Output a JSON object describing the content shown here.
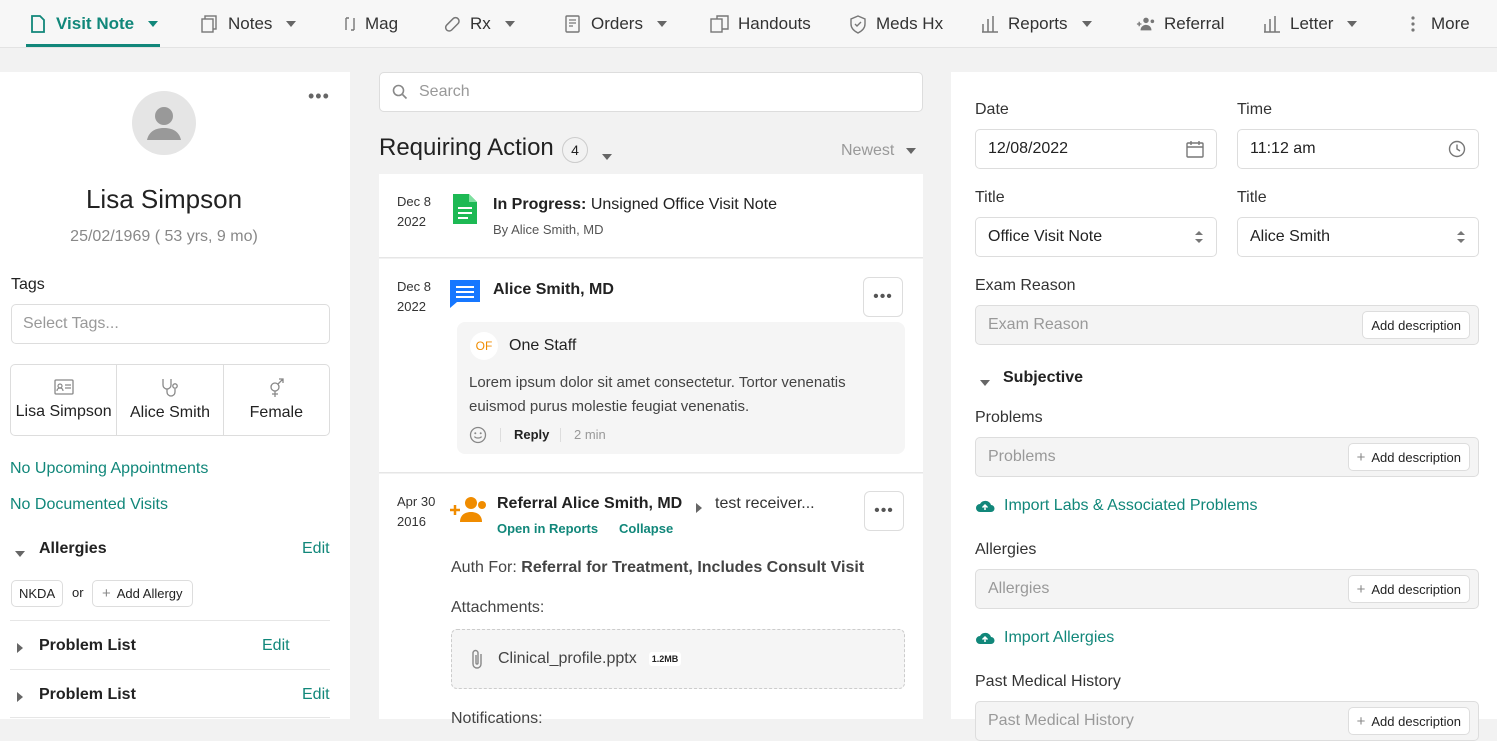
{
  "nav": {
    "items": [
      {
        "label": "Visit Note",
        "icon": "document-icon"
      },
      {
        "label": "Notes",
        "icon": "notes-icon"
      },
      {
        "label": "Mag",
        "icon": "mag-icon"
      },
      {
        "label": "Rx",
        "icon": "pill-icon"
      },
      {
        "label": "Orders",
        "icon": "orders-icon"
      },
      {
        "label": "Handouts",
        "icon": "handouts-icon"
      },
      {
        "label": "Meds Hx",
        "icon": "shield-icon"
      },
      {
        "label": "Reports",
        "icon": "bar-chart-icon"
      },
      {
        "label": "Referral",
        "icon": "people-icon"
      },
      {
        "label": "Letter",
        "icon": "bar-chart-icon"
      },
      {
        "label": "More",
        "icon": "kebab-icon"
      }
    ]
  },
  "patient": {
    "name": "Lisa Simpson",
    "dob": "25/02/1969 ( 53 yrs, 9 mo)",
    "tags_label": "Tags",
    "tags_placeholder": "Select Tags...",
    "info": [
      {
        "label": "Lisa Simpson",
        "icon": "id-card-icon"
      },
      {
        "label": "Alice Smith",
        "icon": "stethoscope-icon"
      },
      {
        "label": "Female",
        "icon": "gender-icon"
      }
    ],
    "no_appointments": "No Upcoming Appointments",
    "no_visits": "No Documented Visits",
    "allergies_title": "Allergies",
    "edit": "Edit",
    "nkda": "NKDA",
    "or": "or",
    "add_allergy": "Add Allergy",
    "problem_list_1": "Problem List",
    "problem_list_2": "Problem List"
  },
  "feed": {
    "search_placeholder": "Search",
    "title": "Requiring Action",
    "count": "4",
    "sort": "Newest",
    "items": [
      {
        "date_md": "Dec 8",
        "date_y": "2022",
        "title_bold": "In Progress:",
        "title_rest": "Unsigned Office Visit Note",
        "subtitle": "By Alice Smith, MD"
      },
      {
        "date_md": "Dec 8",
        "date_y": "2022",
        "title": "Alice Smith, MD",
        "staff_initials": "OF",
        "staff_name": "One Staff",
        "message": "Lorem ipsum dolor sit amet consectetur. Tortor venenatis euismod purus molestie feugiat venenatis.",
        "reply": "Reply",
        "time": "2 min"
      },
      {
        "date_md": "Apr 30",
        "date_y": "2016",
        "title": "Referral Alice Smith, MD",
        "receiver": "test receiver...",
        "open_reports": "Open in Reports",
        "collapse": "Collapse",
        "auth_label": "Auth For:",
        "auth_value": "Referral for Treatment, Includes Consult Visit",
        "attachments_label": "Attachments:",
        "file_name": "Clinical_profile.pptx",
        "file_size": "1.2MB",
        "notifications_label": "Notifications:"
      }
    ]
  },
  "form": {
    "date_label": "Date",
    "date_value": "12/08/2022",
    "time_label": "Time",
    "time_value": "11:12 am",
    "title_label_1": "Title",
    "title_value_1": "Office Visit Note",
    "title_label_2": "Title",
    "title_value_2": "Alice Smith",
    "exam_label": "Exam Reason",
    "exam_placeholder": "Exam Reason",
    "add_description": "Add description",
    "subjective": "Subjective",
    "problems_label": "Problems",
    "problems_placeholder": "Problems",
    "import_labs": "Import Labs & Associated Problems",
    "allergies_label": "Allergies",
    "allergies_placeholder": "Allergies",
    "import_allergies": "Import Allergies",
    "pmh_label": "Past Medical History",
    "pmh_placeholder": "Past Medical History"
  },
  "colors": {
    "accent": "#11877a",
    "doc_green": "#1db954",
    "chat_blue": "#1677ff",
    "referral_orange": "#f08c00"
  }
}
